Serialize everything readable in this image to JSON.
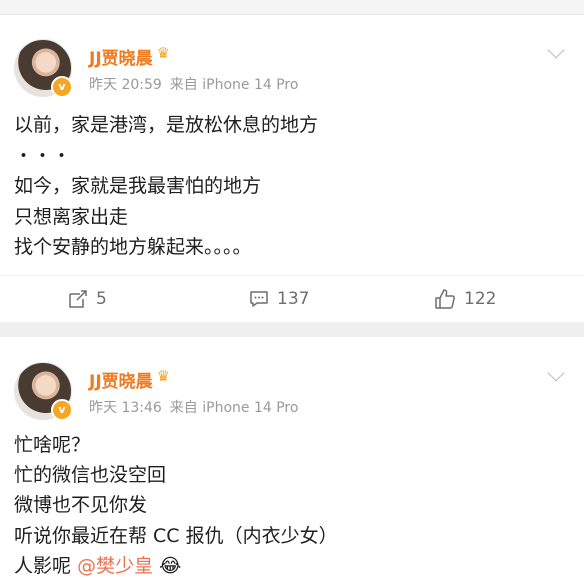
{
  "posts": [
    {
      "author": "JJ贾晓晨",
      "time": "昨天 20:59",
      "source": "来自 iPhone 14 Pro",
      "lines": [
        "以前，家是港湾，是放松休息的地方",
        "・・・",
        "如今，家就是我最害怕的地方",
        "只想离家出走",
        "找个安静的地方躲起来。。。。"
      ],
      "reposts": "5",
      "comments": "137",
      "likes": "122"
    },
    {
      "author": "JJ贾晓晨",
      "time": "昨天 13:46",
      "source": "来自 iPhone 14 Pro",
      "lines": [
        "忙啥呢？",
        "忙的微信也没空回",
        "微博也不见你发",
        "听说你最近在帮 CC 报仇（内衣少女）"
      ],
      "last_line_prefix": "人影呢",
      "mention": "@樊少皇",
      "emoji": "😂"
    }
  ],
  "icons": {
    "crown": "crown-icon",
    "verified": "verified-badge-icon",
    "repost": "repost-icon",
    "comment": "comment-icon",
    "like": "like-icon",
    "more": "chevron-down-icon"
  },
  "colors": {
    "name": "#f07a1f",
    "meta": "#9a9a9a",
    "mention": "#eb7350",
    "divider": "#f0f0f0"
  }
}
